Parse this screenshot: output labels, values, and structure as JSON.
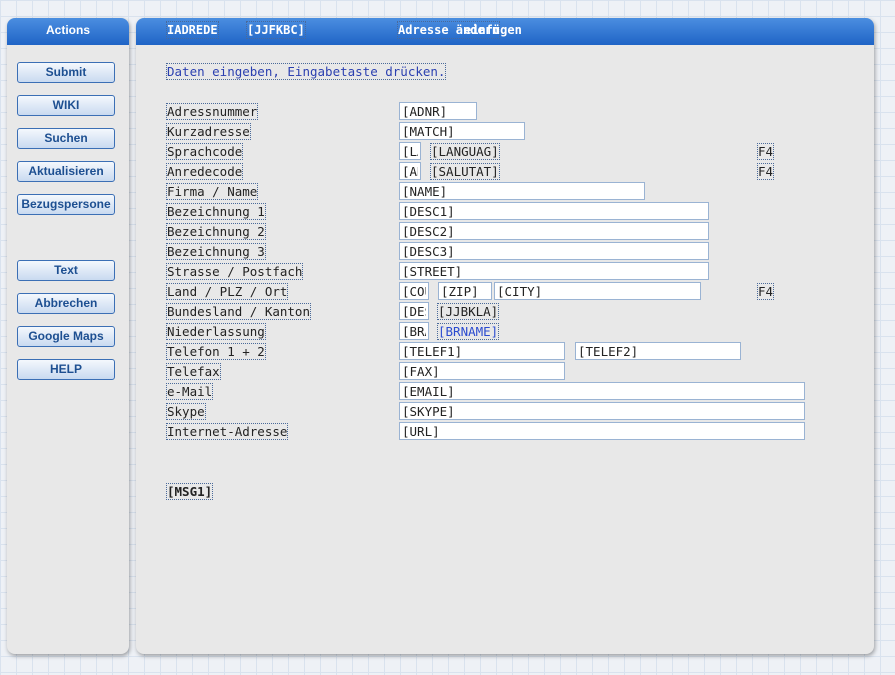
{
  "actions": {
    "title": "Actions",
    "buttons": [
      "Submit",
      "WIKI",
      "Suchen",
      "Aktualisieren",
      "Bezugspersone",
      "Text",
      "Abbrechen",
      "Google Maps",
      "HELP"
    ]
  },
  "header": {
    "program": "IADREDE",
    "code": "[JJFKBC]",
    "title": "Adresse ändern",
    "title_overlay": "einfügen"
  },
  "instruction": "Daten eingeben, Eingabetaste drücken.",
  "labels": [
    "Adressnummer",
    "Kurzadresse",
    "Sprachcode",
    "Anredecode",
    "Firma / Name",
    "Bezeichnung 1",
    "Bezeichnung 2",
    "Bezeichnung 3",
    "Strasse / Postfach",
    "Land / PLZ / Ort",
    "Bundesland / Kanton",
    "Niederlassung",
    "Telefon 1 + 2",
    "Telefax",
    "e-Mail",
    "Skype",
    "Internet-Adresse"
  ],
  "fields": {
    "adnr": "[ADNR]",
    "match": "[MATCH]",
    "la": "[LA",
    "languag": "[LANGUAG]",
    "an": "[AN",
    "salutat": "[SALUTAT]",
    "name": "[NAME]",
    "desc1": "[DESC1]",
    "desc2": "[DESC2]",
    "desc3": "[DESC3]",
    "street": "[STREET]",
    "cou": "[COU",
    "zip": "[ZIP]",
    "city": "[CITY]",
    "des": "[DES",
    "jjbkla": "[JJBKLA]",
    "bra": "[BRA",
    "brname": "[BRNAME]",
    "telef1": "[TELEF1]",
    "telef2": "[TELEF2]",
    "fax": "[FAX]",
    "email": "[EMAIL]",
    "skype": "[SKYPE]",
    "url": "[URL]"
  },
  "f4": "F4",
  "message": "[MSG1]",
  "colors": {
    "header": "#1f64c6",
    "link_text": "#2a4bd0",
    "button_text": "#1d4f91"
  }
}
